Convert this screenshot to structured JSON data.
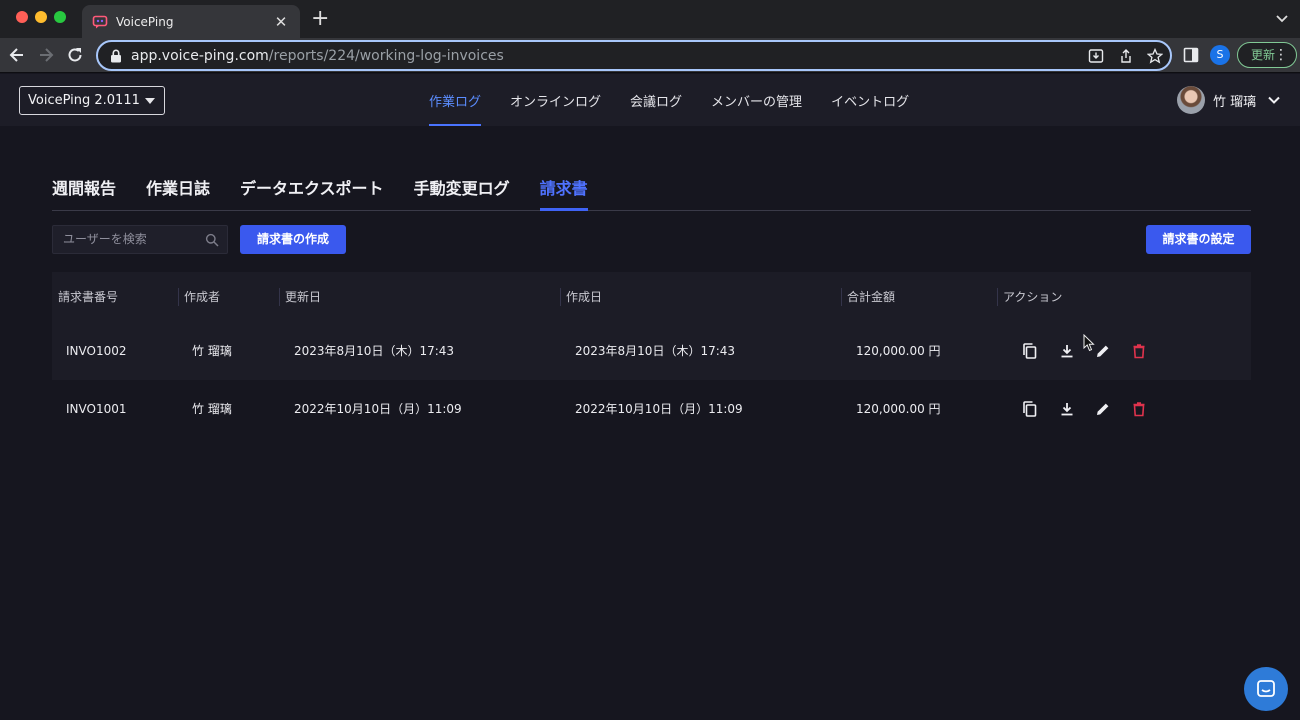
{
  "browser": {
    "tab_title": "VoicePing",
    "url_host": "app.voice-ping.com",
    "url_path": "/reports/224/working-log-invoices",
    "profile_initial": "S",
    "update_label": "更新"
  },
  "header": {
    "workspace": "VoicePing 2.0111",
    "nav": [
      "作業ログ",
      "オンラインログ",
      "会議ログ",
      "メンバーの管理",
      "イベントログ"
    ],
    "active_nav": "作業ログ",
    "user_name": "竹 瑠璃"
  },
  "subtabs": {
    "items": [
      "週間報告",
      "作業日誌",
      "データエクスポート",
      "手動変更ログ",
      "請求書"
    ],
    "active": "請求書"
  },
  "controls": {
    "search_placeholder": "ユーザーを検索",
    "create_button": "請求書の作成",
    "settings_button": "請求書の設定"
  },
  "table": {
    "columns": [
      "請求書番号",
      "作成者",
      "更新日",
      "作成日",
      "合計金額",
      "アクション"
    ],
    "rows": [
      {
        "number": "INVO1002",
        "author": "竹 瑠璃",
        "updated": "2023年8月10日（木）17:43",
        "created": "2023年8月10日（木）17:43",
        "total": "120,000.00 円"
      },
      {
        "number": "INVO1001",
        "author": "竹 瑠璃",
        "updated": "2022年10月10日（月）11:09",
        "created": "2022年10月10日（月）11:09",
        "total": "120,000.00 円"
      }
    ]
  },
  "colors": {
    "accent": "#3a59ee",
    "background": "#16161f",
    "delete": "#e0334d"
  }
}
